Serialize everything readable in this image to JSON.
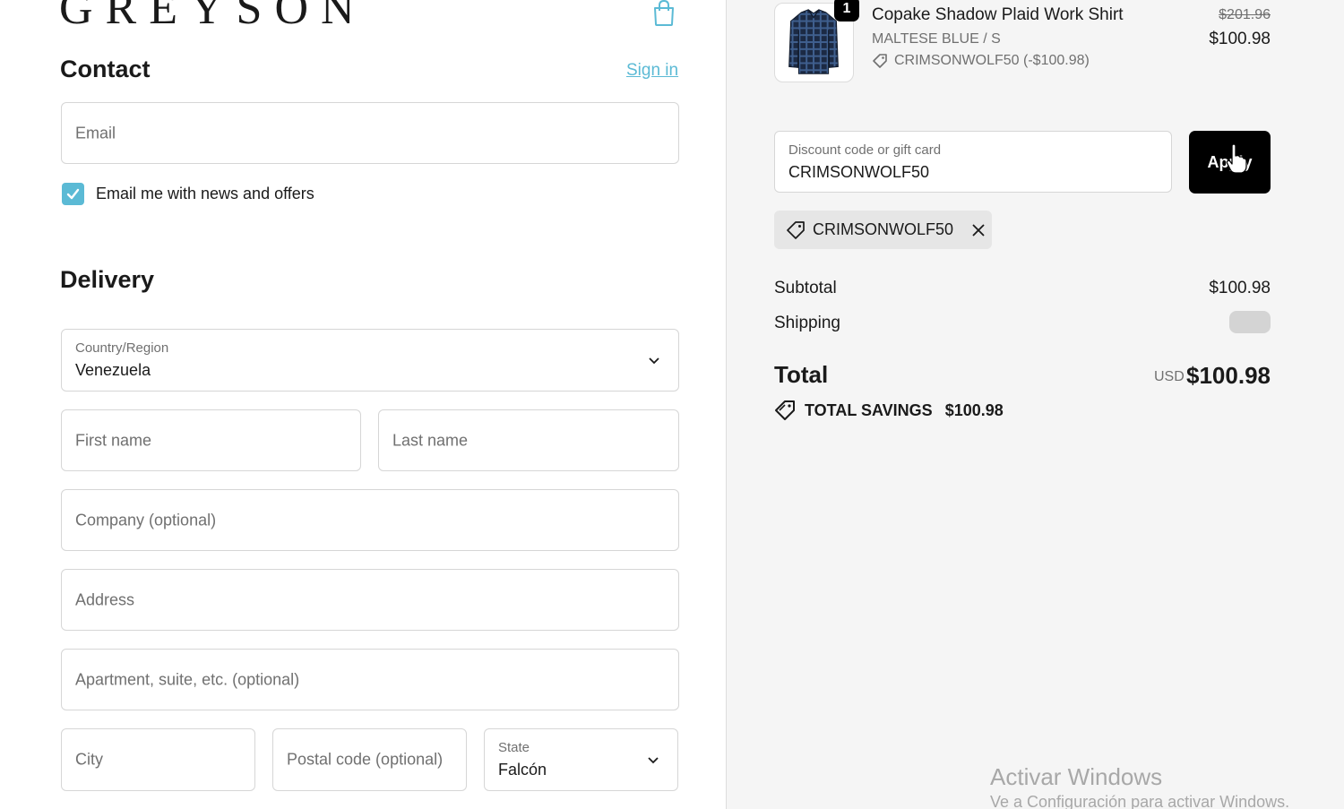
{
  "brand": {
    "logo_text": "GREYSON"
  },
  "header": {
    "cart_icon": "shopping-bag-icon"
  },
  "contact": {
    "title": "Contact",
    "sign_in_label": "Sign in",
    "email_placeholder": "Email",
    "newsletter_label": "Email me with news and offers",
    "newsletter_checked": true
  },
  "delivery": {
    "title": "Delivery",
    "country_label": "Country/Region",
    "country_value": "Venezuela",
    "first_name_placeholder": "First name",
    "last_name_placeholder": "Last name",
    "company_placeholder": "Company (optional)",
    "address_placeholder": "Address",
    "apartment_placeholder": "Apartment, suite, etc. (optional)",
    "city_placeholder": "City",
    "postal_placeholder": "Postal code (optional)",
    "state_label": "State",
    "state_value": "Falcón"
  },
  "order": {
    "item": {
      "quantity": "1",
      "name": "Copake Shadow Plaid Work Shirt",
      "variant": "MALTESE BLUE / S",
      "discount_line": "CRIMSONWOLF50 (-$100.98)",
      "original_price": "$201.96",
      "price": "$100.98"
    },
    "discount": {
      "label": "Discount code or gift card",
      "value": "CRIMSONWOLF50",
      "apply_label": "Apply",
      "applied_code": "CRIMSONWOLF50"
    },
    "summary": {
      "subtotal_label": "Subtotal",
      "subtotal_value": "$100.98",
      "shipping_label": "Shipping",
      "total_label": "Total",
      "currency": "USD",
      "total_value": "$100.98",
      "savings_label": "TOTAL SAVINGS",
      "savings_value": "$100.98"
    }
  },
  "watermark": {
    "title": "Activar Windows",
    "subtitle": "Ve a Configuración para activar Windows."
  },
  "colors": {
    "accent": "#5bbad5",
    "button": "#000000",
    "sidebar_bg": "#f5f5f5"
  }
}
